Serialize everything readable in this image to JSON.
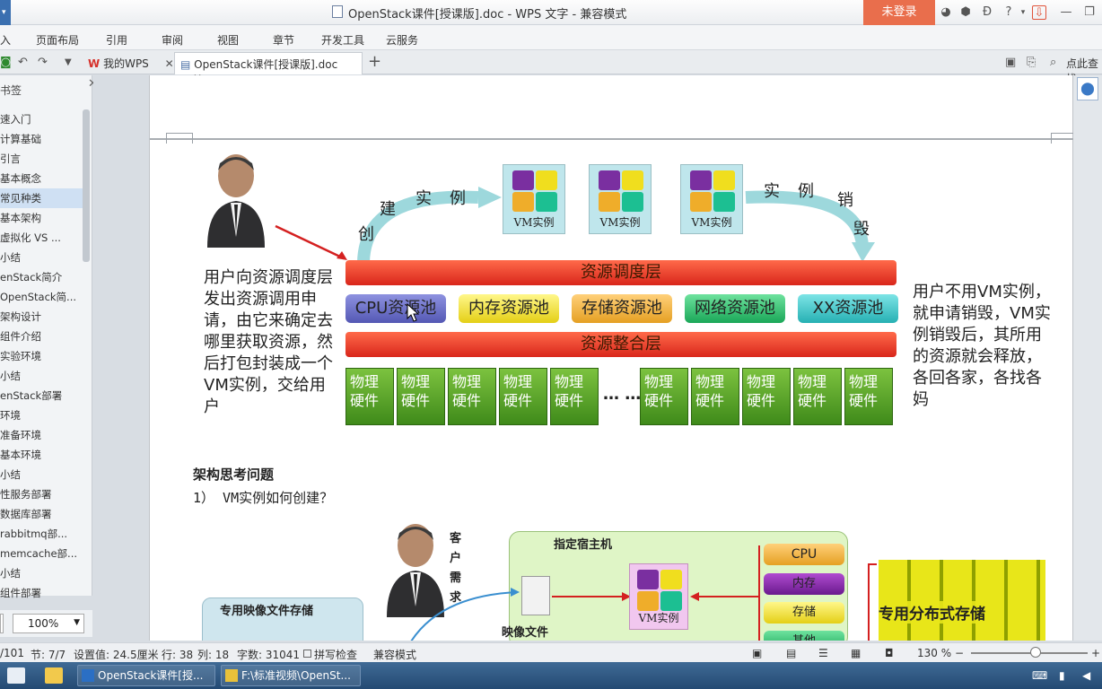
{
  "window": {
    "title": "OpenStack课件[授课版].doc - WPS 文字 - 兼容模式",
    "login": "未登录"
  },
  "menu": [
    "入",
    "页面布局",
    "引用",
    "审阅",
    "视图",
    "章节",
    "开发工具",
    "云服务"
  ],
  "tabs": {
    "home": "我的WPS",
    "doc": "OpenStack课件[授课版].doc",
    "search": "点此查找"
  },
  "sidebar": {
    "title": "书签",
    "items": [
      "速入门",
      "计算基础",
      "引言",
      "基本概念",
      "常见种类",
      "基本架构",
      "虚拟化 VS ...",
      "小结",
      "enStack简介",
      "OpenStack简...",
      "架构设计",
      "组件介绍",
      "实验环境",
      "小结",
      "enStack部署",
      "环境",
      "准备环境",
      "基本环境",
      "小结",
      "性服务部署",
      "数据库部署",
      "rabbitmq部...",
      "memcache部...",
      "小结",
      "组件部署"
    ],
    "selected_index": 4,
    "zoom": "100%"
  },
  "diagram1": {
    "create_label": [
      "创",
      "建",
      "实",
      "例"
    ],
    "destroy_label": [
      "实",
      "例",
      "销",
      "毁"
    ],
    "vm_label": "VM实例",
    "scheduler_layer": "资源调度层",
    "pools": [
      "CPU资源池",
      "内存资源池",
      "存储资源池",
      "网络资源池",
      "XX资源池"
    ],
    "integration_layer": "资源整合层",
    "hardware": "物理硬件",
    "ellipsis": "… …",
    "left_text": "用户向资源调度层发出资源调用申请，由它来确定去哪里获取资源，然后打包封装成一个VM实例，交给用户",
    "right_text": "用户不用VM实例，就申请销毁，VM实例销毁后，其所用的资源就会释放，各回各家，各找各妈",
    "colors": {
      "scheduler": "#e8362b",
      "cpu": "#6a6ec8",
      "mem": "#f0e437",
      "storage": "#f0b53a",
      "network": "#2cbf6a",
      "xx": "#3cc6c9"
    }
  },
  "section": {
    "heading": "架构思考问题",
    "item1": "1） VM实例如何创建？"
  },
  "diagram2": {
    "image_store": "专用映像文件存储",
    "customer": [
      "客",
      "户",
      "需",
      "求"
    ],
    "host": "指定宿主机",
    "image_file": "映像文件",
    "vm_label": "VM实例",
    "resources": [
      "CPU",
      "内存",
      "存储",
      "其他"
    ],
    "dist_storage": "专用分布式存储"
  },
  "status": {
    "page": "/101",
    "section": "节: 7/7",
    "setting": "设置值: 24.5厘米",
    "row": "行: 38",
    "col": "列: 18",
    "words": "字数: 31041",
    "spell": "拼写检查",
    "compat": "兼容模式",
    "zoom": "130 %"
  },
  "taskbar": {
    "app1": "OpenStack课件[授...",
    "app2": "F:\\标准视频\\OpenSt..."
  }
}
